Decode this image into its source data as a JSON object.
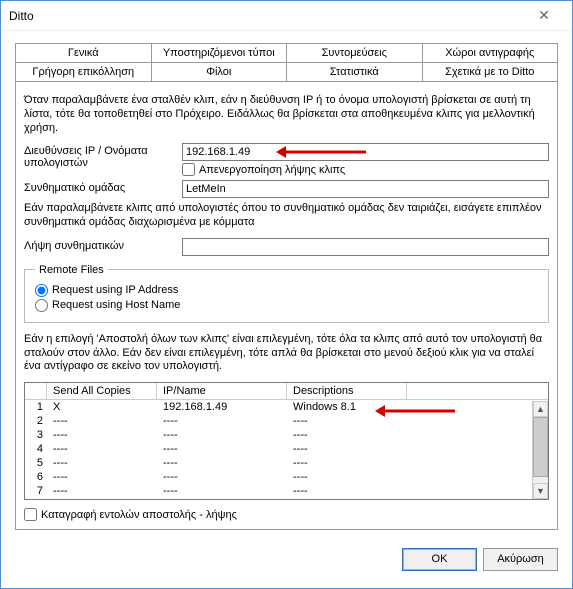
{
  "window": {
    "title": "Ditto"
  },
  "tabs": {
    "row1": [
      "Γενικά",
      "Υποστηριζόμενοι τύποι",
      "Συντομεύσεις",
      "Χώροι αντιγραφής"
    ],
    "row2": [
      "Γρήγορη επικόλληση",
      "Φίλοι",
      "Στατιστικά",
      "Σχετικά με το Ditto"
    ],
    "active": "Φίλοι"
  },
  "friends": {
    "intro": "Όταν παραλαμβάνετε ένα σταλθέν κλιπ, εάν η διεύθυνση IP ή το όνομα υπολογιστή βρίσκεται σε αυτή τη λίστα, τότε θα τοποθετηθεί στο Πρόχειρο. Ειδάλλως θα βρίσκεται στα αποθηκευμένα κλιπς για μελλοντική χρήση.",
    "ip_label": "Διευθύνσεις IP / Ονόματα υπολογιστών",
    "ip_value": "192.168.1.49",
    "disable_receive_label": "Απενεργοποίηση λήψης κλιπς",
    "disable_receive_checked": false,
    "group_pass_label": "Συνθηματικό ομάδας",
    "group_pass_value": "LetMeIn",
    "extra_pass_desc": "Εάν παραλαμβάνετε κλιπς από υπολογιστές όπου το συνθηματικό ομάδας δεν ταιριάζει, εισάγετε επιπλέον συνθηματικά ομάδας διαχωρισμένα με κόμματα",
    "extra_pass_label": "Λήψη συνθηματικών",
    "extra_pass_value": "",
    "remote_group_label": "Remote Files",
    "radio_ip": "Request using IP Address",
    "radio_host": "Request using Host Name",
    "radio_selected": "ip",
    "send_desc": "Εάν η επιλογή 'Αποστολή όλων των κλιπς' είναι επιλεγμένη, τότε όλα τα κλιπς από αυτό τον υπολογιστή θα σταλούν στον άλλο. Εάν δεν είναι επιλεγμένη, τότε απλά θα βρίσκεται στο μενού δεξιού κλικ για να σταλεί ένα αντίγραφο σε εκείνο τον υπολογιστή.",
    "log_label": "Καταγραφή εντολών αποστολής - λήψης",
    "log_checked": false
  },
  "table": {
    "headers": [
      "",
      "Send All Copies",
      "IP/Name",
      "Descriptions",
      ""
    ],
    "rows": [
      {
        "n": "1",
        "send": "X",
        "ip": "192.168.1.49",
        "desc": "Windows 8.1"
      },
      {
        "n": "2",
        "send": "----",
        "ip": "----",
        "desc": "----"
      },
      {
        "n": "3",
        "send": "----",
        "ip": "----",
        "desc": "----"
      },
      {
        "n": "4",
        "send": "----",
        "ip": "----",
        "desc": "----"
      },
      {
        "n": "5",
        "send": "----",
        "ip": "----",
        "desc": "----"
      },
      {
        "n": "6",
        "send": "----",
        "ip": "----",
        "desc": "----"
      },
      {
        "n": "7",
        "send": "----",
        "ip": "----",
        "desc": "----"
      }
    ]
  },
  "buttons": {
    "ok": "OK",
    "cancel": "Ακύρωση"
  }
}
